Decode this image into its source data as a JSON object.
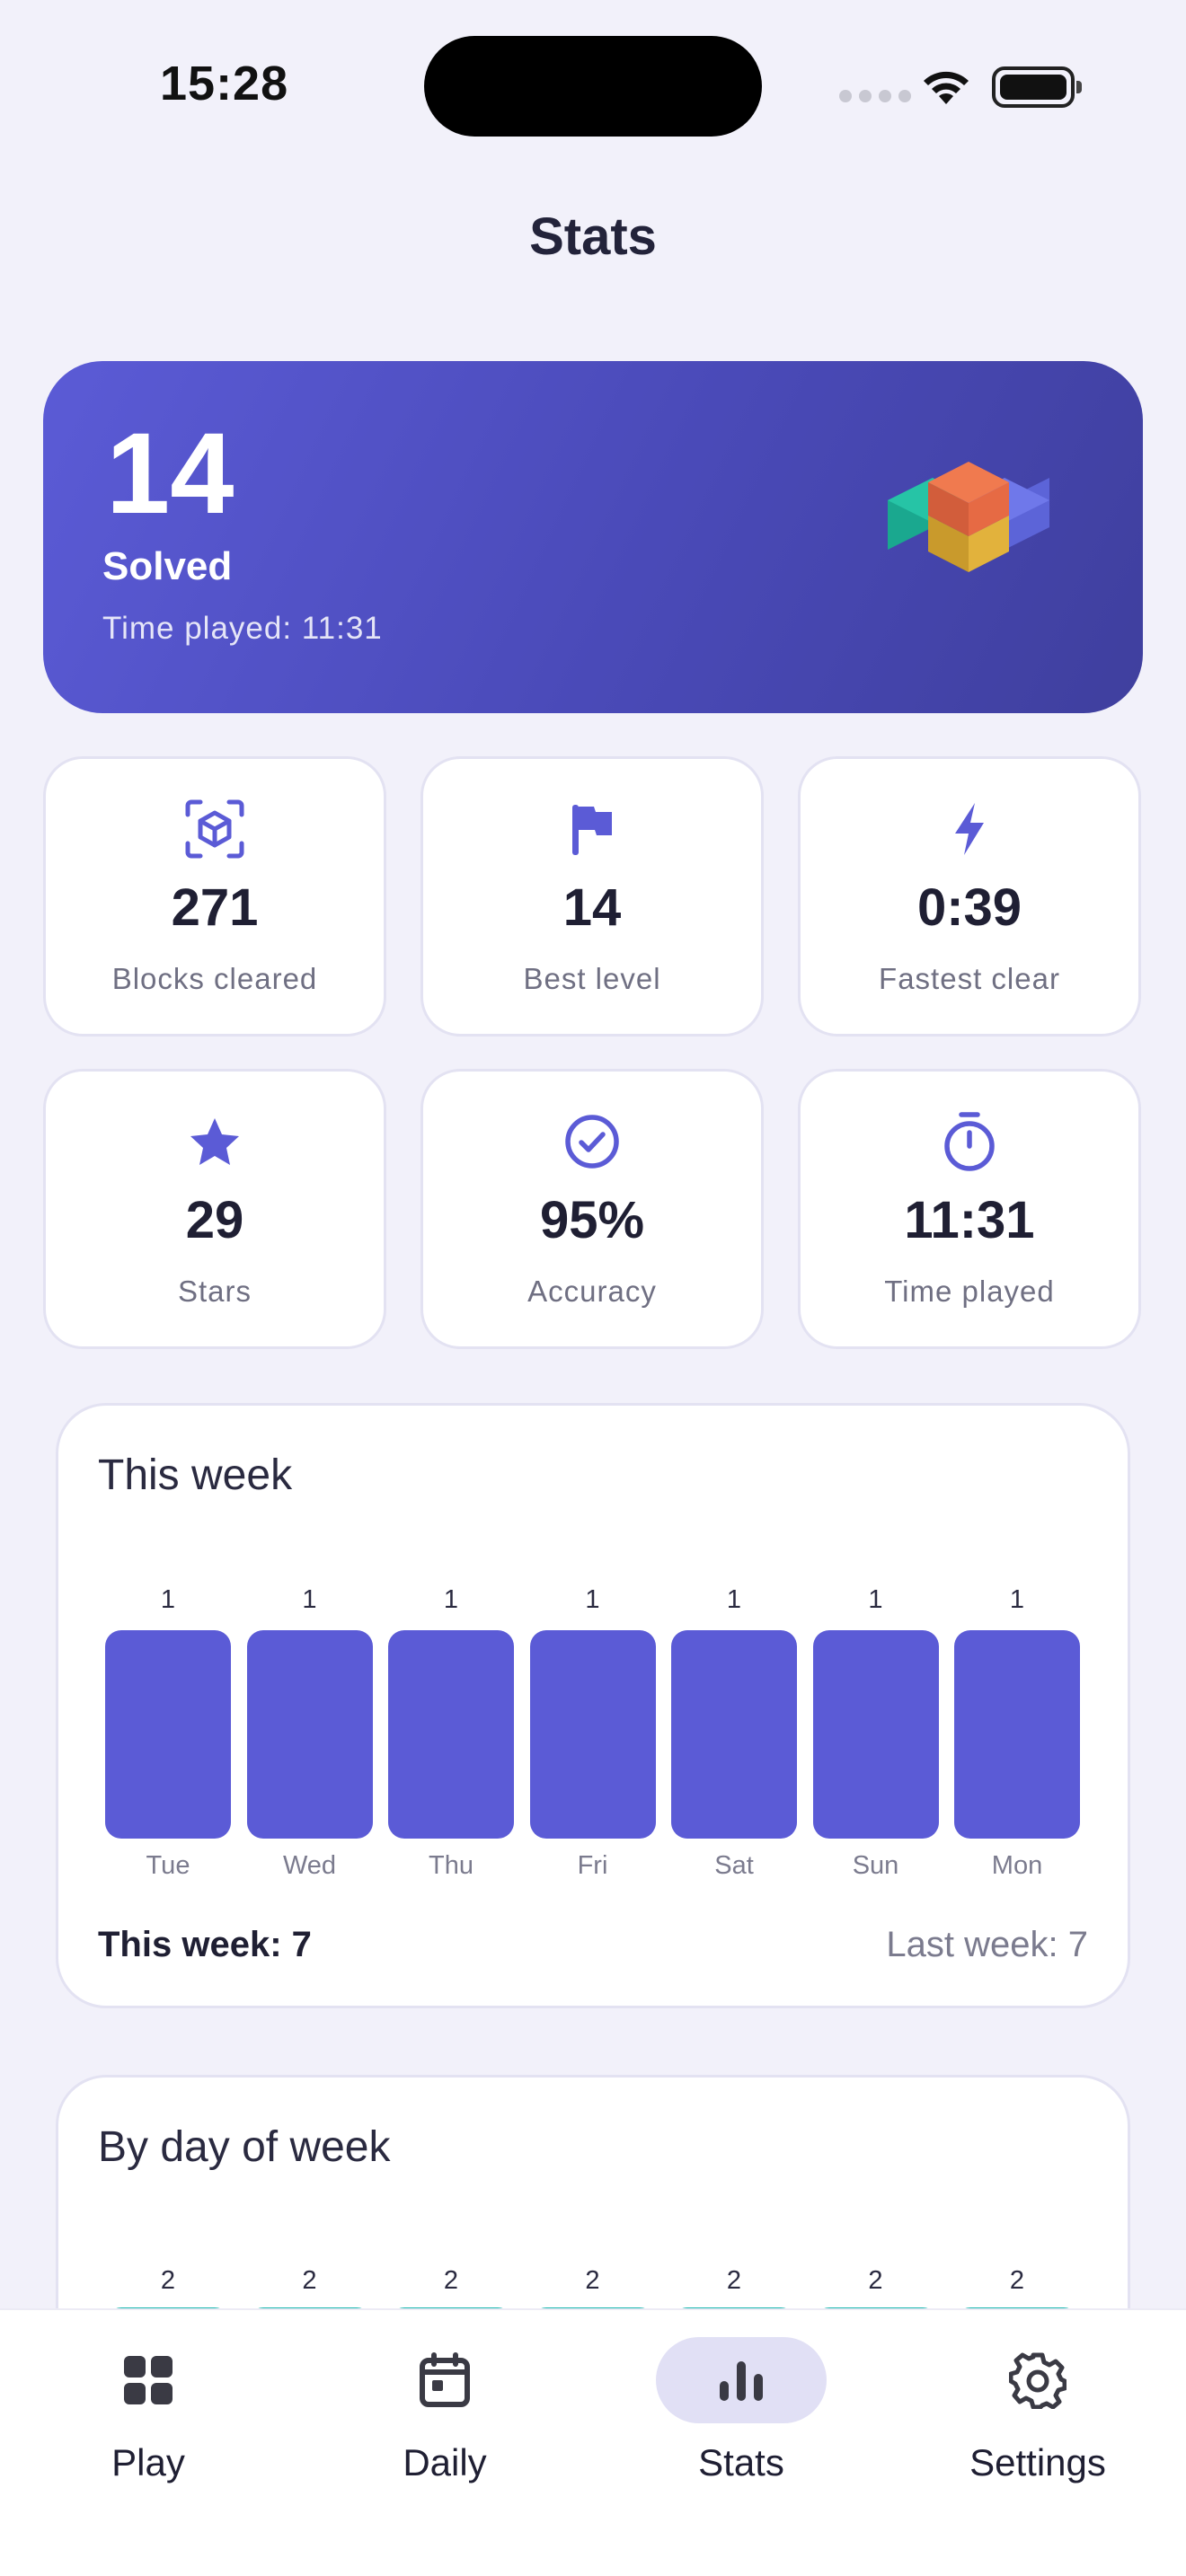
{
  "status_bar": {
    "time": "15:28"
  },
  "header": {
    "title": "Stats"
  },
  "hero": {
    "solved_count": "14",
    "solved_label": "Solved",
    "time_played": "Time played: 11:31"
  },
  "stat_cards": [
    {
      "icon": "cube-scan-icon",
      "value": "271",
      "label": "Blocks cleared"
    },
    {
      "icon": "flag-icon",
      "value": "14",
      "label": "Best level"
    },
    {
      "icon": "lightning-icon",
      "value": "0:39",
      "label": "Fastest clear"
    },
    {
      "icon": "star-icon",
      "value": "29",
      "label": "Stars"
    },
    {
      "icon": "check-circle-icon",
      "value": "95%",
      "label": "Accuracy"
    },
    {
      "icon": "stopwatch-icon",
      "value": "11:31",
      "label": "Time played"
    }
  ],
  "this_week": {
    "title": "This week",
    "days": [
      "Tue",
      "Wed",
      "Thu",
      "Fri",
      "Sat",
      "Sun",
      "Mon"
    ],
    "values": [
      1,
      1,
      1,
      1,
      1,
      1,
      1
    ],
    "value_labels": [
      "1",
      "1",
      "1",
      "1",
      "1",
      "1",
      "1"
    ],
    "total": "This week: 7",
    "last_week": "Last week: 7"
  },
  "by_day_of_week": {
    "title": "By day of week",
    "values": [
      2,
      2,
      2,
      2,
      2,
      2,
      2
    ],
    "value_labels": [
      "2",
      "2",
      "2",
      "2",
      "2",
      "2",
      "2"
    ]
  },
  "tab_bar": {
    "tabs": [
      {
        "label": "Play",
        "icon": "grid-icon"
      },
      {
        "label": "Daily",
        "icon": "calendar-icon"
      },
      {
        "label": "Stats",
        "icon": "bar-chart-icon",
        "active": true
      },
      {
        "label": "Settings",
        "icon": "gear-icon"
      }
    ]
  },
  "colors": {
    "accent": "#5b5bd6",
    "teal": "#19b7b0",
    "background": "#f2f1fa"
  }
}
